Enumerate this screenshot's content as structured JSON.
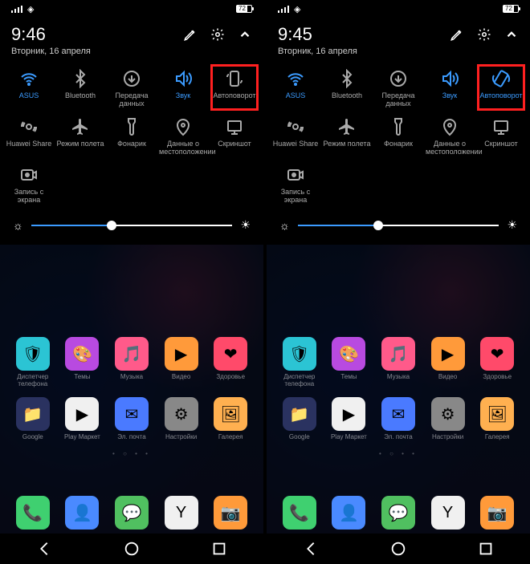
{
  "left": {
    "time": "9:46",
    "date": "Вторник, 16 апреля",
    "battery": "72",
    "tiles_row1": [
      {
        "label": "ASUS",
        "icon": "wifi",
        "active": true
      },
      {
        "label": "Bluetooth",
        "icon": "bt",
        "active": false
      },
      {
        "label": "Передача данных",
        "icon": "data",
        "active": false
      },
      {
        "label": "Звук",
        "icon": "sound",
        "active": true
      },
      {
        "label": "Автоповорот",
        "icon": "rotate-off",
        "active": false,
        "highlight": true
      }
    ],
    "tiles_row2": [
      {
        "label": "Huawei Share",
        "icon": "share",
        "active": false
      },
      {
        "label": "Режим полета",
        "icon": "plane",
        "active": false
      },
      {
        "label": "Фонарик",
        "icon": "torch",
        "active": false
      },
      {
        "label": "Данные о местоположении",
        "icon": "loc",
        "active": false
      },
      {
        "label": "Скриншот",
        "icon": "shot",
        "active": false
      }
    ],
    "tiles_row3": [
      {
        "label": "Запись с экрана",
        "icon": "rec",
        "active": false
      }
    ]
  },
  "right": {
    "time": "9:45",
    "date": "Вторник, 16 апреля",
    "battery": "72",
    "tiles_row1": [
      {
        "label": "ASUS",
        "icon": "wifi",
        "active": true
      },
      {
        "label": "Bluetooth",
        "icon": "bt",
        "active": false
      },
      {
        "label": "Передача данных",
        "icon": "data",
        "active": false
      },
      {
        "label": "Звук",
        "icon": "sound",
        "active": true
      },
      {
        "label": "Автоповорот",
        "icon": "rotate-on",
        "active": true,
        "highlight": true
      }
    ],
    "tiles_row2": [
      {
        "label": "Huawei Share",
        "icon": "share",
        "active": false
      },
      {
        "label": "Режим полета",
        "icon": "plane",
        "active": false
      },
      {
        "label": "Фонарик",
        "icon": "torch",
        "active": false
      },
      {
        "label": "Данные о местоположении",
        "icon": "loc",
        "active": false
      },
      {
        "label": "Скриншот",
        "icon": "shot",
        "active": false
      }
    ],
    "tiles_row3": [
      {
        "label": "Запись с экрана",
        "icon": "rec",
        "active": false
      }
    ]
  },
  "apps_row1": [
    {
      "label": "Диспетчер телефона",
      "bg": "#2bc4d4",
      "txt": "🛡"
    },
    {
      "label": "Темы",
      "bg": "#b84ae0",
      "txt": "🎨"
    },
    {
      "label": "Музыка",
      "bg": "#ff5a8a",
      "txt": "🎵"
    },
    {
      "label": "Видео",
      "bg": "#ff9a3a",
      "txt": "▶"
    },
    {
      "label": "Здоровье",
      "bg": "#ff4a6a",
      "txt": "❤"
    }
  ],
  "apps_row2": [
    {
      "label": "Google",
      "bg": "#2a3260",
      "txt": "📁"
    },
    {
      "label": "Play Маркет",
      "bg": "#f0f0f0",
      "txt": "▶"
    },
    {
      "label": "Эл. почта",
      "bg": "#4a7aff",
      "txt": "✉"
    },
    {
      "label": "Настройки",
      "bg": "#888",
      "txt": "⚙"
    },
    {
      "label": "Галерея",
      "bg": "#ffb050",
      "txt": "🖼"
    }
  ],
  "dock": [
    {
      "label": "",
      "bg": "#3fd070",
      "txt": "📞"
    },
    {
      "label": "",
      "bg": "#4a8aff",
      "txt": "👤"
    },
    {
      "label": "",
      "bg": "#50c060",
      "txt": "💬"
    },
    {
      "label": "",
      "bg": "#f0f0f0",
      "txt": "Y"
    },
    {
      "label": "",
      "bg": "#ff9a3a",
      "txt": "📷"
    }
  ]
}
